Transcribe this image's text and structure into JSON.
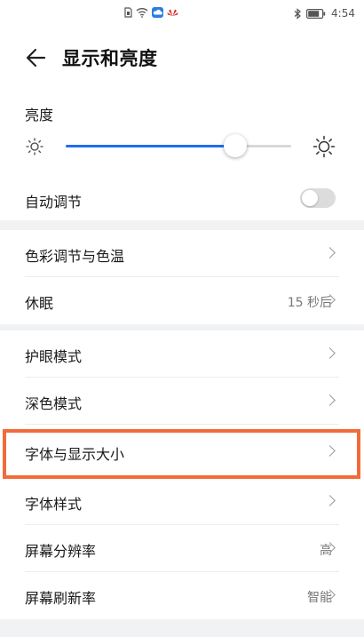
{
  "status_bar": {
    "time": "4:54",
    "icons": [
      "sim-card-icon",
      "wifi-icon",
      "cloud-icon",
      "huawei-logo-icon",
      "bluetooth-icon",
      "battery-icon"
    ]
  },
  "header": {
    "title": "显示和亮度",
    "back_icon": "back-arrow-icon"
  },
  "brightness": {
    "label": "亮度",
    "level": 0.75,
    "auto_label": "自动调节",
    "auto_enabled": false
  },
  "sections": [
    {
      "items": [
        {
          "label": "色彩调节与色温",
          "value": ""
        },
        {
          "label": "休眠",
          "value": "15 秒后"
        }
      ]
    },
    {
      "items": [
        {
          "label": "护眼模式",
          "value": ""
        },
        {
          "label": "深色模式",
          "value": ""
        },
        {
          "label": "字体与显示大小",
          "value": "",
          "highlighted": true
        },
        {
          "label": "字体样式",
          "value": ""
        },
        {
          "label": "屏幕分辨率",
          "value": "高"
        },
        {
          "label": "屏幕刷新率",
          "value": "智能"
        }
      ]
    }
  ],
  "colors": {
    "accent": "#1f6ef0",
    "highlight_border": "#f26b3a",
    "background": "#f1f2f4"
  }
}
